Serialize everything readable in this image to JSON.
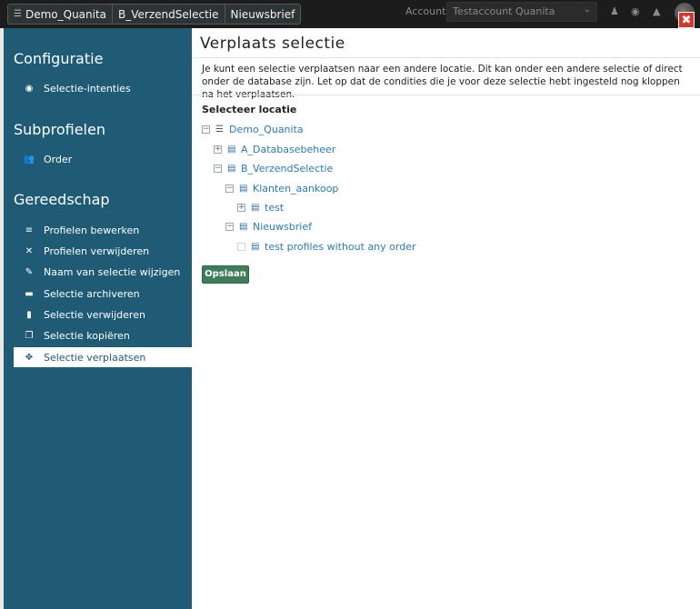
{
  "topbar": {
    "breadcrumbs": [
      "Demo_Quanita",
      "B_VerzendSelectie",
      "Nieuwsbrief"
    ],
    "account_label": "Account",
    "account_value": "Testaccount Quanita",
    "icons": [
      "user-secret-icon",
      "eye-icon",
      "bell-icon"
    ],
    "close_glyph": "✖"
  },
  "sidebar": {
    "sections": {
      "configuratie": {
        "title": "Configuratie",
        "items": [
          {
            "label": "Selectie-intenties",
            "icon": "circle-dot-icon"
          }
        ]
      },
      "subprofielen": {
        "title": "Subprofielen",
        "items": [
          {
            "label": "Order",
            "icon": "users-icon"
          }
        ]
      },
      "gereedschap": {
        "title": "Gereedschap",
        "items": [
          {
            "label": "Profielen bewerken",
            "icon": "sliders-icon"
          },
          {
            "label": "Profielen verwijderen",
            "icon": "user-remove-icon"
          },
          {
            "label": "Naam van selectie wijzigen",
            "icon": "edit-icon"
          },
          {
            "label": "Selectie archiveren",
            "icon": "archive-icon"
          },
          {
            "label": "Selectie verwijderen",
            "icon": "trash-icon"
          },
          {
            "label": "Selectie kopiëren",
            "icon": "copy-icon"
          },
          {
            "label": "Selectie verplaatsen",
            "icon": "move-icon",
            "active": true
          }
        ]
      }
    }
  },
  "main": {
    "title": "Verplaats selectie",
    "description": "Je kunt een selectie verplaatsen naar een andere locatie. Dit kan onder een andere selectie of direct onder de database zijn. Let op dat de condities die je voor deze selectie hebt ingesteld nog kloppen na het verplaatsen.",
    "location_title": "Selecteer locatie",
    "tree": [
      {
        "label": "Demo_Quanita",
        "toggle": "⊟",
        "icon": "database-icon"
      },
      {
        "label": "A_Databasebeheer",
        "toggle": "⊞",
        "icon": "filter-doc-icon"
      },
      {
        "label": "B_VerzendSelectie",
        "toggle": "⊟",
        "icon": "filter-doc-icon"
      },
      {
        "label": "Klanten_aankoop",
        "toggle": "⊟",
        "icon": "filter-doc-icon"
      },
      {
        "label": "test",
        "toggle": "⊞",
        "icon": "filter-doc-icon"
      },
      {
        "label": "Nieuwsbrief",
        "toggle": "⊟",
        "icon": "filter-doc-icon"
      },
      {
        "label": "test profiles without any order",
        "toggle": "",
        "icon": "filter-doc-icon"
      }
    ],
    "save_label": "Opslaan"
  }
}
